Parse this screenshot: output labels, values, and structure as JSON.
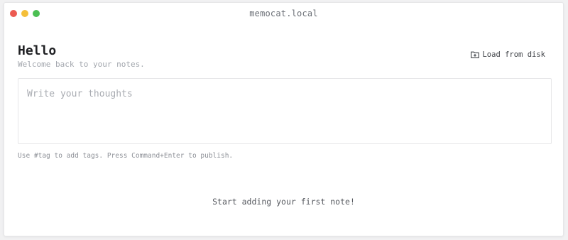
{
  "window": {
    "title": "memocat.local",
    "controls": {
      "close_color": "#ec5a51",
      "minimize_color": "#f4bf3a",
      "maximize_color": "#4bbf53"
    }
  },
  "header": {
    "greeting": "Hello",
    "subtitle": "Welcome back to your notes."
  },
  "toolbar": {
    "load_label": "Load from disk",
    "load_icon": "folder-plus-icon"
  },
  "composer": {
    "placeholder": "Write your thoughts",
    "value": "",
    "hint": "Use #tag to add tags. Press Command+Enter to publish."
  },
  "notes": {
    "empty_message": "Start adding your first note!"
  }
}
